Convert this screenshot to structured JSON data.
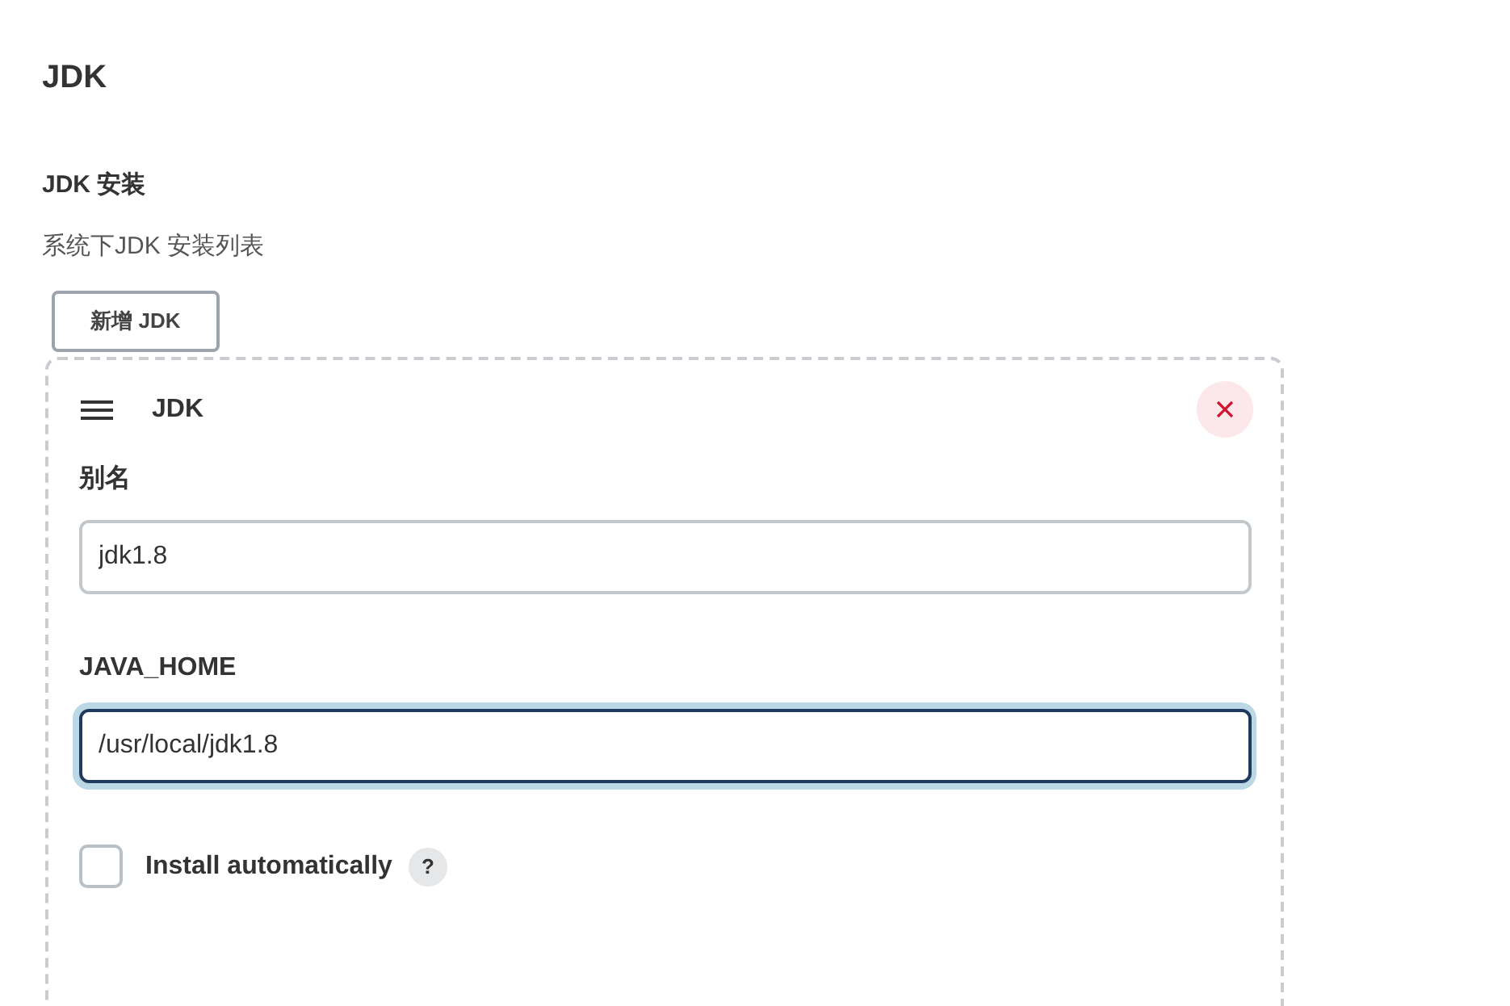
{
  "section_title": "JDK",
  "setting": {
    "label": "JDK 安装",
    "description": "系统下JDK 安装列表"
  },
  "add_button": {
    "label": "新增 JDK"
  },
  "item": {
    "title": "JDK",
    "fields": [
      {
        "label": "别名",
        "value": "jdk1.8",
        "focused": false
      },
      {
        "label": "JAVA_HOME",
        "value": "/usr/local/jdk1.8",
        "focused": true
      }
    ],
    "install_automatically": {
      "label": "Install automatically",
      "checked": false,
      "help": "?"
    }
  }
}
